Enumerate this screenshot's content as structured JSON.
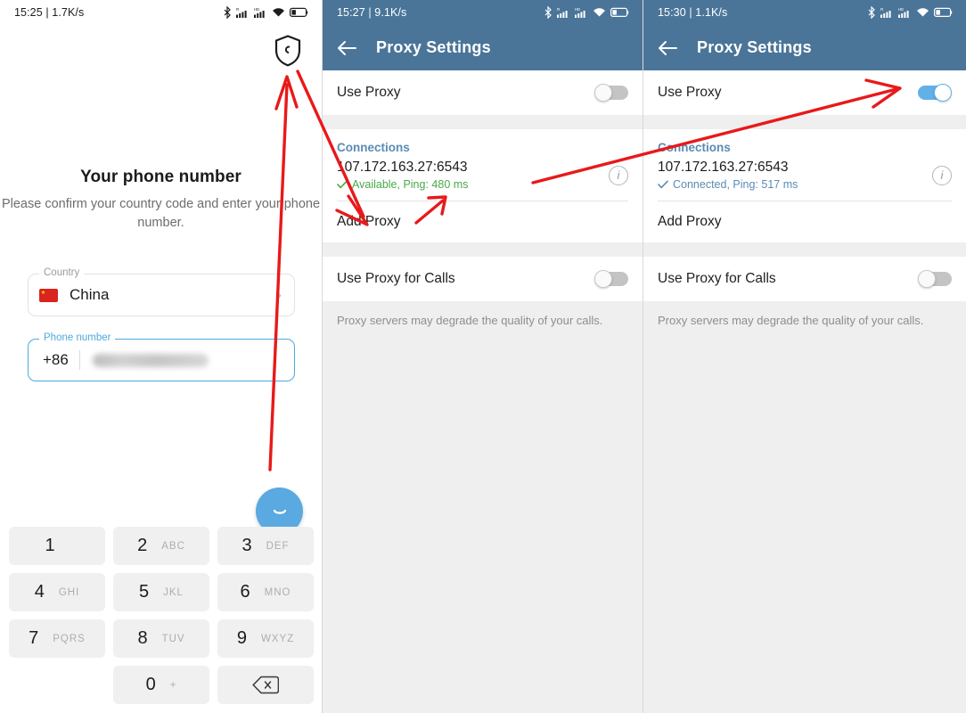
{
  "screens": {
    "phone_number": {
      "statusbar": {
        "clock": "15:25 | 1.7K/s",
        "icons": [
          "bluetooth-icon",
          "signal-roaming-icon",
          "signal-hd-icon",
          "wifi-icon",
          "battery-icon"
        ]
      },
      "shield_icon": "shield-call-icon",
      "title": "Your phone number",
      "subtitle": "Please confirm your country code and enter your phone number.",
      "country_field": {
        "label": "Country",
        "value": "China",
        "flag": "flag-china",
        "chevron": "chevron-right-icon"
      },
      "phone_field": {
        "label": "Phone number",
        "country_code": "+86",
        "value": ""
      },
      "fab_icon": "arrow-next-icon",
      "keypad": [
        {
          "digit": "1",
          "letters": ""
        },
        {
          "digit": "2",
          "letters": "ABC"
        },
        {
          "digit": "3",
          "letters": "DEF"
        },
        {
          "digit": "4",
          "letters": "GHI"
        },
        {
          "digit": "5",
          "letters": "JKL"
        },
        {
          "digit": "6",
          "letters": "MNO"
        },
        {
          "digit": "7",
          "letters": "PQRS"
        },
        {
          "digit": "8",
          "letters": "TUV"
        },
        {
          "digit": "9",
          "letters": "WXYZ"
        },
        {
          "digit": "0",
          "letters": "+"
        }
      ],
      "backspace_icon": "backspace-icon"
    },
    "proxy_off": {
      "statusbar": {
        "clock": "15:27 | 9.1K/s"
      },
      "back_icon": "back-arrow-icon",
      "title": "Proxy Settings",
      "use_proxy": {
        "label": "Use Proxy",
        "state": "off"
      },
      "connections": {
        "title": "Connections",
        "address": "107.172.163.27:6543",
        "status": "Available, Ping: 480 ms",
        "status_color": "#4aa84a",
        "check_icon": "check-icon",
        "info_icon": "info-icon"
      },
      "add_proxy": "Add Proxy",
      "use_proxy_calls": {
        "label": "Use Proxy for Calls",
        "state": "off"
      },
      "footnote": "Proxy servers may degrade the quality of your calls."
    },
    "proxy_on": {
      "statusbar": {
        "clock": "15:30 | 1.1K/s"
      },
      "back_icon": "back-arrow-icon",
      "title": "Proxy Settings",
      "use_proxy": {
        "label": "Use Proxy",
        "state": "on"
      },
      "connections": {
        "title": "Connections",
        "address": "107.172.163.27:6543",
        "status": "Connected, Ping: 517 ms",
        "status_color": "#5b8bb4",
        "check_icon": "check-icon",
        "info_icon": "info-icon"
      },
      "add_proxy": "Add Proxy",
      "use_proxy_calls": {
        "label": "Use Proxy for Calls",
        "state": "off"
      },
      "footnote": "Proxy servers may degrade the quality of your calls."
    }
  },
  "theme": {
    "appbar_blue": "#4a7599",
    "accent_blue": "#5aa9e0",
    "available_green": "#4aa84a",
    "connected_blue": "#5b8bb4",
    "annotation_red": "#e8191a"
  }
}
